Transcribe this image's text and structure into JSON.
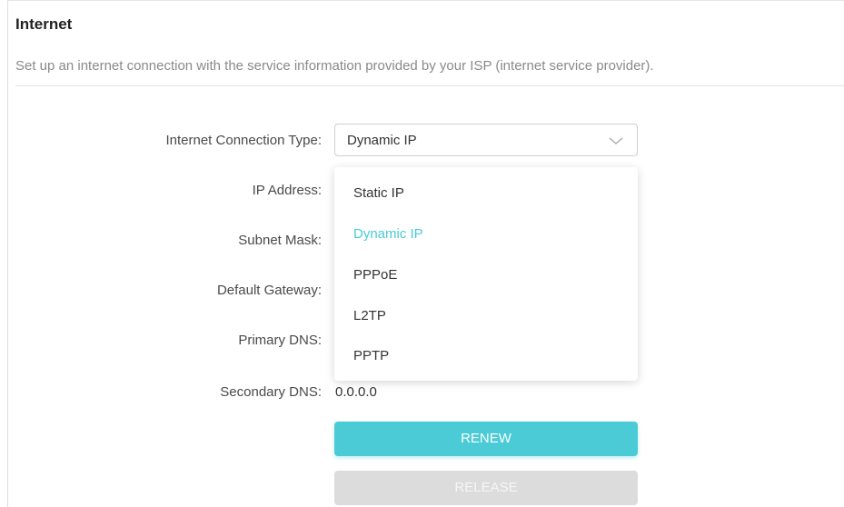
{
  "section": {
    "title": "Internet",
    "description": "Set up an internet connection with the service information provided by your ISP (internet service provider)."
  },
  "form": {
    "connection_type_label": "Internet Connection Type:",
    "connection_type_value": "Dynamic IP",
    "ip_address_label": "IP Address:",
    "subnet_mask_label": "Subnet Mask:",
    "default_gateway_label": "Default Gateway:",
    "primary_dns_label": "Primary DNS:",
    "secondary_dns_label": "Secondary DNS:",
    "secondary_dns_value": "0.0.0.0"
  },
  "dropdown": {
    "options": [
      {
        "label": "Static IP",
        "selected": false
      },
      {
        "label": "Dynamic IP",
        "selected": true
      },
      {
        "label": "PPPoE",
        "selected": false
      },
      {
        "label": "L2TP",
        "selected": false
      },
      {
        "label": "PPTP",
        "selected": false
      }
    ]
  },
  "buttons": {
    "renew_label": "RENEW",
    "release_label": "RELEASE"
  },
  "colors": {
    "accent": "#4acbd6",
    "disabled_button": "#dcdcdc",
    "label_text": "#4a4a4a",
    "description_text": "#8a8a8a"
  },
  "icons": {
    "select_chevron": "chevron-down-icon"
  }
}
